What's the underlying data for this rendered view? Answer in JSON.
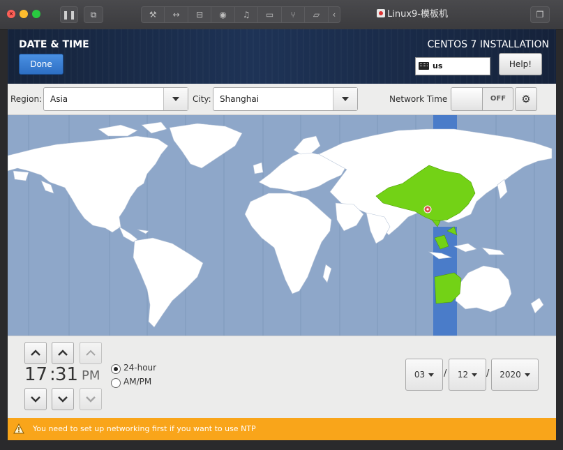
{
  "vm_window": {
    "title": "Linux9-模板机",
    "traffic_lights": [
      "close",
      "minimize",
      "zoom"
    ]
  },
  "header": {
    "page_title": "DATE & TIME",
    "product": "CENTOS 7 INSTALLATION",
    "done_label": "Done",
    "help_label": "Help!",
    "keyboard_layout": "us"
  },
  "toolbar": {
    "region_label": "Region:",
    "region_value": "Asia",
    "city_label": "City:",
    "city_value": "Shanghai",
    "network_time_label": "Network Time",
    "network_time_state": "OFF"
  },
  "map": {
    "selected_timezone": "Asia/Shanghai",
    "ocean_color": "#8ea7c9",
    "land_color": "#ffffff",
    "highlight_color": "#73d216",
    "band_color": "#4a7cc9"
  },
  "time": {
    "hours": "17",
    "separator": ":",
    "minutes": "31",
    "ampm": "PM",
    "format_24_label": "24-hour",
    "format_ampm_label": "AM/PM",
    "selected_format": "24-hour"
  },
  "date": {
    "month": "03",
    "day": "12",
    "year": "2020",
    "separator": "/"
  },
  "warning": {
    "text": "You need to set up networking first if you want to use NTP",
    "color": "#f9a51a"
  }
}
